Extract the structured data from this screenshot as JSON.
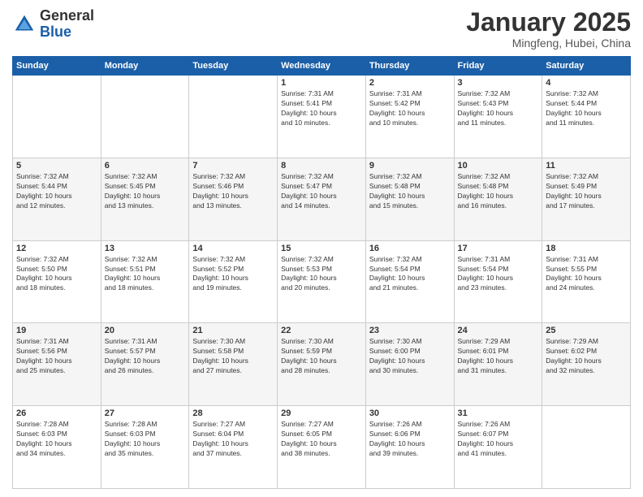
{
  "logo": {
    "general": "General",
    "blue": "Blue"
  },
  "header": {
    "month": "January 2025",
    "location": "Mingfeng, Hubei, China"
  },
  "weekdays": [
    "Sunday",
    "Monday",
    "Tuesday",
    "Wednesday",
    "Thursday",
    "Friday",
    "Saturday"
  ],
  "weeks": [
    [
      {
        "day": "",
        "info": ""
      },
      {
        "day": "",
        "info": ""
      },
      {
        "day": "",
        "info": ""
      },
      {
        "day": "1",
        "info": "Sunrise: 7:31 AM\nSunset: 5:41 PM\nDaylight: 10 hours\nand 10 minutes."
      },
      {
        "day": "2",
        "info": "Sunrise: 7:31 AM\nSunset: 5:42 PM\nDaylight: 10 hours\nand 10 minutes."
      },
      {
        "day": "3",
        "info": "Sunrise: 7:32 AM\nSunset: 5:43 PM\nDaylight: 10 hours\nand 11 minutes."
      },
      {
        "day": "4",
        "info": "Sunrise: 7:32 AM\nSunset: 5:44 PM\nDaylight: 10 hours\nand 11 minutes."
      }
    ],
    [
      {
        "day": "5",
        "info": "Sunrise: 7:32 AM\nSunset: 5:44 PM\nDaylight: 10 hours\nand 12 minutes."
      },
      {
        "day": "6",
        "info": "Sunrise: 7:32 AM\nSunset: 5:45 PM\nDaylight: 10 hours\nand 13 minutes."
      },
      {
        "day": "7",
        "info": "Sunrise: 7:32 AM\nSunset: 5:46 PM\nDaylight: 10 hours\nand 13 minutes."
      },
      {
        "day": "8",
        "info": "Sunrise: 7:32 AM\nSunset: 5:47 PM\nDaylight: 10 hours\nand 14 minutes."
      },
      {
        "day": "9",
        "info": "Sunrise: 7:32 AM\nSunset: 5:48 PM\nDaylight: 10 hours\nand 15 minutes."
      },
      {
        "day": "10",
        "info": "Sunrise: 7:32 AM\nSunset: 5:48 PM\nDaylight: 10 hours\nand 16 minutes."
      },
      {
        "day": "11",
        "info": "Sunrise: 7:32 AM\nSunset: 5:49 PM\nDaylight: 10 hours\nand 17 minutes."
      }
    ],
    [
      {
        "day": "12",
        "info": "Sunrise: 7:32 AM\nSunset: 5:50 PM\nDaylight: 10 hours\nand 18 minutes."
      },
      {
        "day": "13",
        "info": "Sunrise: 7:32 AM\nSunset: 5:51 PM\nDaylight: 10 hours\nand 18 minutes."
      },
      {
        "day": "14",
        "info": "Sunrise: 7:32 AM\nSunset: 5:52 PM\nDaylight: 10 hours\nand 19 minutes."
      },
      {
        "day": "15",
        "info": "Sunrise: 7:32 AM\nSunset: 5:53 PM\nDaylight: 10 hours\nand 20 minutes."
      },
      {
        "day": "16",
        "info": "Sunrise: 7:32 AM\nSunset: 5:54 PM\nDaylight: 10 hours\nand 21 minutes."
      },
      {
        "day": "17",
        "info": "Sunrise: 7:31 AM\nSunset: 5:54 PM\nDaylight: 10 hours\nand 23 minutes."
      },
      {
        "day": "18",
        "info": "Sunrise: 7:31 AM\nSunset: 5:55 PM\nDaylight: 10 hours\nand 24 minutes."
      }
    ],
    [
      {
        "day": "19",
        "info": "Sunrise: 7:31 AM\nSunset: 5:56 PM\nDaylight: 10 hours\nand 25 minutes."
      },
      {
        "day": "20",
        "info": "Sunrise: 7:31 AM\nSunset: 5:57 PM\nDaylight: 10 hours\nand 26 minutes."
      },
      {
        "day": "21",
        "info": "Sunrise: 7:30 AM\nSunset: 5:58 PM\nDaylight: 10 hours\nand 27 minutes."
      },
      {
        "day": "22",
        "info": "Sunrise: 7:30 AM\nSunset: 5:59 PM\nDaylight: 10 hours\nand 28 minutes."
      },
      {
        "day": "23",
        "info": "Sunrise: 7:30 AM\nSunset: 6:00 PM\nDaylight: 10 hours\nand 30 minutes."
      },
      {
        "day": "24",
        "info": "Sunrise: 7:29 AM\nSunset: 6:01 PM\nDaylight: 10 hours\nand 31 minutes."
      },
      {
        "day": "25",
        "info": "Sunrise: 7:29 AM\nSunset: 6:02 PM\nDaylight: 10 hours\nand 32 minutes."
      }
    ],
    [
      {
        "day": "26",
        "info": "Sunrise: 7:28 AM\nSunset: 6:03 PM\nDaylight: 10 hours\nand 34 minutes."
      },
      {
        "day": "27",
        "info": "Sunrise: 7:28 AM\nSunset: 6:03 PM\nDaylight: 10 hours\nand 35 minutes."
      },
      {
        "day": "28",
        "info": "Sunrise: 7:27 AM\nSunset: 6:04 PM\nDaylight: 10 hours\nand 37 minutes."
      },
      {
        "day": "29",
        "info": "Sunrise: 7:27 AM\nSunset: 6:05 PM\nDaylight: 10 hours\nand 38 minutes."
      },
      {
        "day": "30",
        "info": "Sunrise: 7:26 AM\nSunset: 6:06 PM\nDaylight: 10 hours\nand 39 minutes."
      },
      {
        "day": "31",
        "info": "Sunrise: 7:26 AM\nSunset: 6:07 PM\nDaylight: 10 hours\nand 41 minutes."
      },
      {
        "day": "",
        "info": ""
      }
    ]
  ]
}
